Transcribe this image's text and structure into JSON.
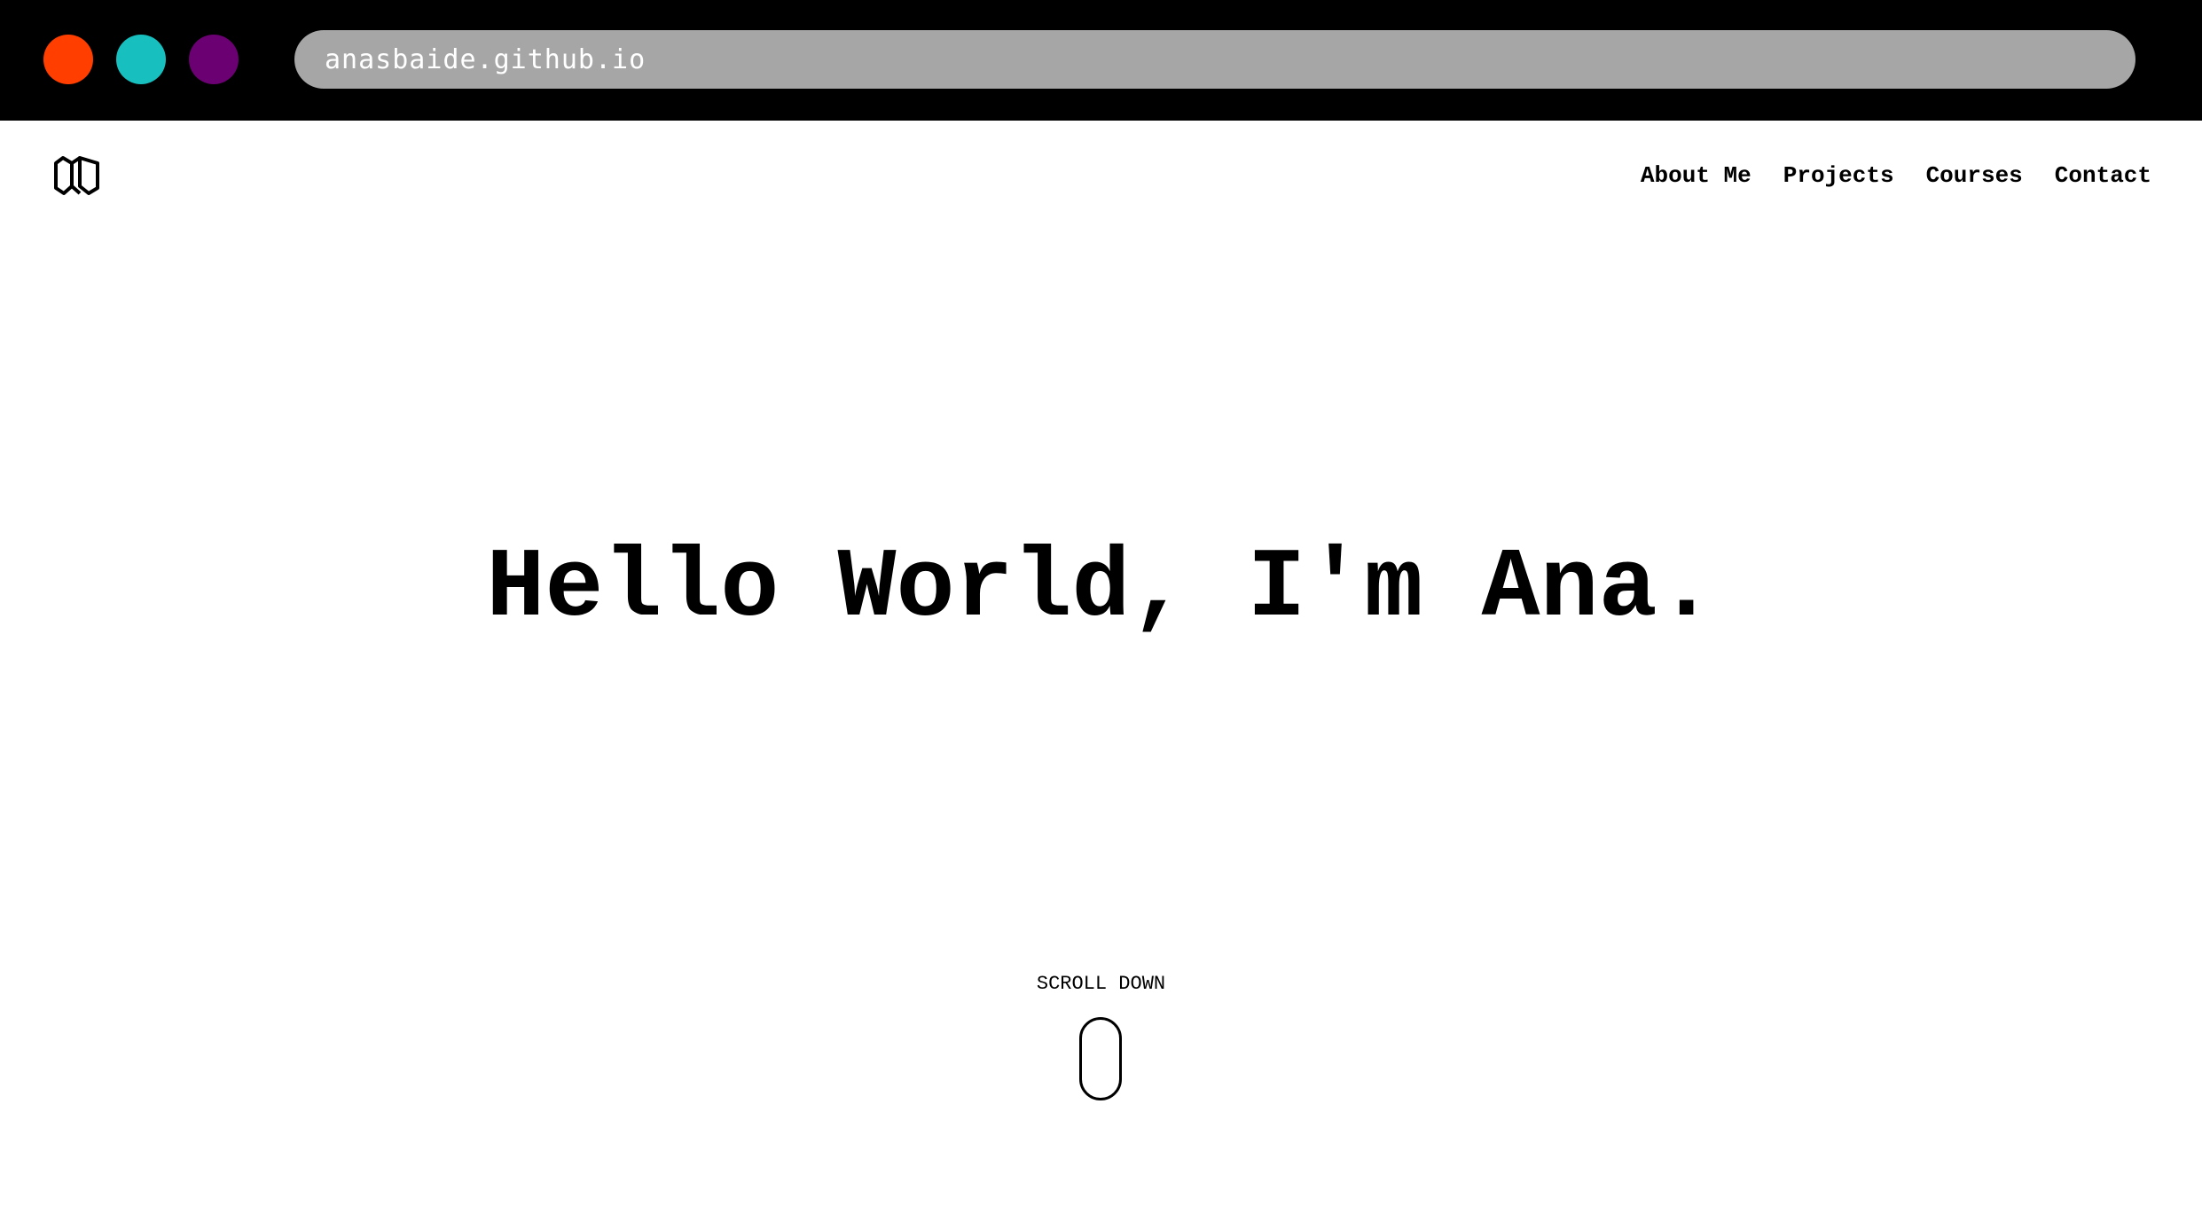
{
  "browser": {
    "window_controls": [
      {
        "name": "close",
        "color": "#ff3e00"
      },
      {
        "name": "minimize",
        "color": "#17bfbf"
      },
      {
        "name": "maximize",
        "color": "#6a0071"
      }
    ],
    "address": "anasbaide.github.io"
  },
  "header": {
    "logo_icon": "monogram-logo-icon",
    "nav": [
      {
        "label": "About Me"
      },
      {
        "label": "Projects"
      },
      {
        "label": "Courses"
      },
      {
        "label": "Contact"
      }
    ]
  },
  "hero": {
    "title": "Hello World, I'm Ana."
  },
  "scroll": {
    "label": "SCROLL DOWN",
    "icon": "mouse-scroll-icon"
  }
}
